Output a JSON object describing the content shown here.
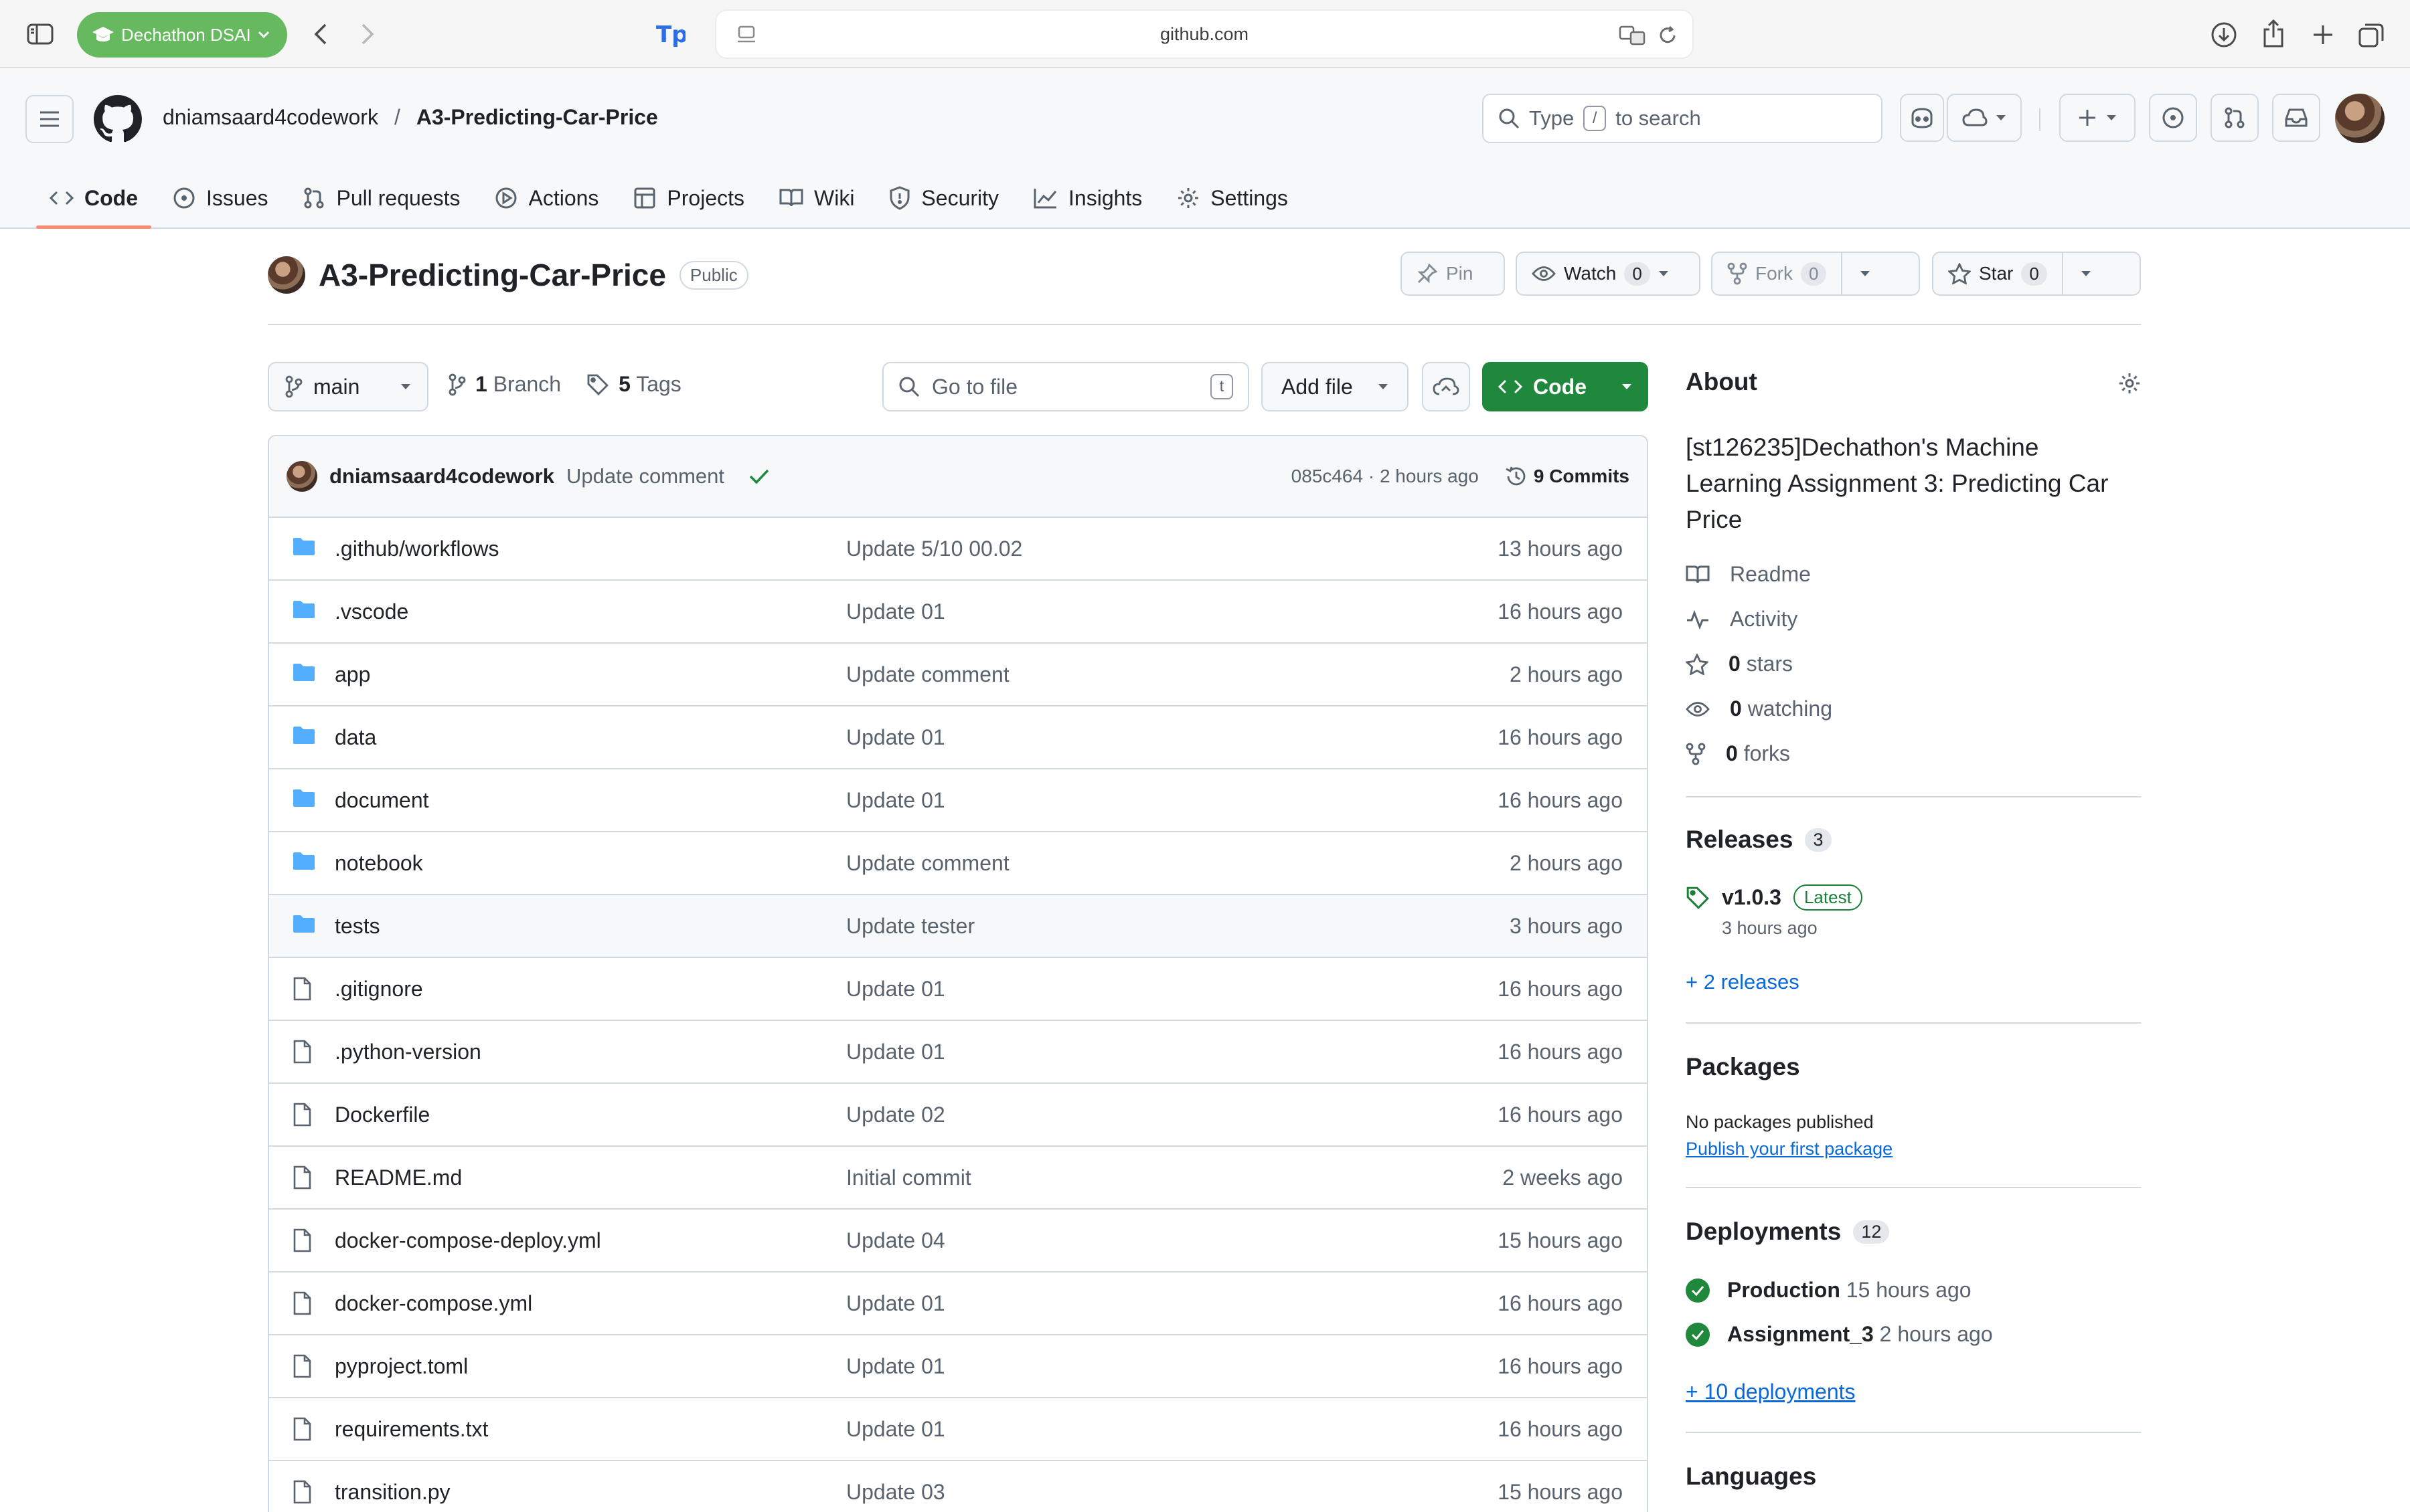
{
  "browser": {
    "profile_label": "Dechathon DSAI",
    "url": "github.com"
  },
  "header": {
    "owner": "dniamsaard4codework",
    "separator": "/",
    "repo": "A3-Predicting-Car-Price",
    "search_prefix": "Type",
    "search_key": "/",
    "search_suffix": "to search"
  },
  "nav": {
    "tabs": [
      {
        "label": "Code",
        "icon": "code-icon",
        "active": true
      },
      {
        "label": "Issues",
        "icon": "issue-opened-icon"
      },
      {
        "label": "Pull requests",
        "icon": "git-pull-request-icon"
      },
      {
        "label": "Actions",
        "icon": "play-icon"
      },
      {
        "label": "Projects",
        "icon": "table-icon"
      },
      {
        "label": "Wiki",
        "icon": "book-icon"
      },
      {
        "label": "Security",
        "icon": "shield-icon"
      },
      {
        "label": "Insights",
        "icon": "graph-icon"
      },
      {
        "label": "Settings",
        "icon": "gear-icon"
      }
    ]
  },
  "repo": {
    "name": "A3-Predicting-Car-Price",
    "visibility": "Public",
    "pin_label": "Pin",
    "watch_label": "Watch",
    "watch_count": "0",
    "fork_label": "Fork",
    "fork_count": "0",
    "star_label": "Star",
    "star_count": "0"
  },
  "controls": {
    "branch": "main",
    "branch_count": "1",
    "branch_label": "Branch",
    "tag_count": "5",
    "tag_label": "Tags",
    "goto_placeholder": "Go to file",
    "goto_key": "t",
    "add_file_label": "Add file",
    "code_label": "Code"
  },
  "commit": {
    "author": "dniamsaard4codework",
    "message": "Update comment",
    "meta": "085c464 · 2 hours ago",
    "commits_label": "9 Commits"
  },
  "files": [
    {
      "name": ".github/workflows",
      "type": "dir",
      "message": "Update 5/10 00.02",
      "time": "13 hours ago"
    },
    {
      "name": ".vscode",
      "type": "dir",
      "message": "Update 01",
      "time": "16 hours ago"
    },
    {
      "name": "app",
      "type": "dir",
      "message": "Update comment",
      "time": "2 hours ago"
    },
    {
      "name": "data",
      "type": "dir",
      "message": "Update 01",
      "time": "16 hours ago"
    },
    {
      "name": "document",
      "type": "dir",
      "message": "Update 01",
      "time": "16 hours ago"
    },
    {
      "name": "notebook",
      "type": "dir",
      "message": "Update comment",
      "time": "2 hours ago"
    },
    {
      "name": "tests",
      "type": "dir",
      "message": "Update tester",
      "time": "3 hours ago",
      "hover": true
    },
    {
      "name": ".gitignore",
      "type": "file",
      "message": "Update 01",
      "time": "16 hours ago"
    },
    {
      "name": ".python-version",
      "type": "file",
      "message": "Update 01",
      "time": "16 hours ago"
    },
    {
      "name": "Dockerfile",
      "type": "file",
      "message": "Update 02",
      "time": "16 hours ago"
    },
    {
      "name": "README.md",
      "type": "file",
      "message": "Initial commit",
      "time": "2 weeks ago"
    },
    {
      "name": "docker-compose-deploy.yml",
      "type": "file",
      "message": "Update 04",
      "time": "15 hours ago"
    },
    {
      "name": "docker-compose.yml",
      "type": "file",
      "message": "Update 01",
      "time": "16 hours ago"
    },
    {
      "name": "pyproject.toml",
      "type": "file",
      "message": "Update 01",
      "time": "16 hours ago"
    },
    {
      "name": "requirements.txt",
      "type": "file",
      "message": "Update 01",
      "time": "16 hours ago"
    },
    {
      "name": "transition.py",
      "type": "file",
      "message": "Update 03",
      "time": "15 hours ago"
    }
  ],
  "about": {
    "title": "About",
    "description": "[st126235]Dechathon's Machine Learning Assignment 3: Predicting Car Price",
    "readme": "Readme",
    "activity": "Activity",
    "stars_count": "0",
    "stars_label": "stars",
    "watching_count": "0",
    "watching_label": "watching",
    "forks_count": "0",
    "forks_label": "forks"
  },
  "releases": {
    "title": "Releases",
    "count": "3",
    "latest_tag": "v1.0.3",
    "latest_badge": "Latest",
    "latest_time": "3 hours ago",
    "more_link": "+ 2 releases"
  },
  "packages": {
    "title": "Packages",
    "empty_text": "No packages published",
    "publish_link": "Publish your first package"
  },
  "deployments": {
    "title": "Deployments",
    "count": "12",
    "items": [
      {
        "env": "Production",
        "time": "15 hours ago"
      },
      {
        "env": "Assignment_3",
        "time": "2 hours ago"
      }
    ],
    "more_link": "+ 10 deployments"
  },
  "languages": {
    "title": "Languages"
  },
  "colors": {
    "accent_green": "#1f883d",
    "folder_blue": "#54aeff",
    "link_blue": "#0969da",
    "tab_underline": "#fd8c73",
    "profile_green": "#66b95e"
  }
}
